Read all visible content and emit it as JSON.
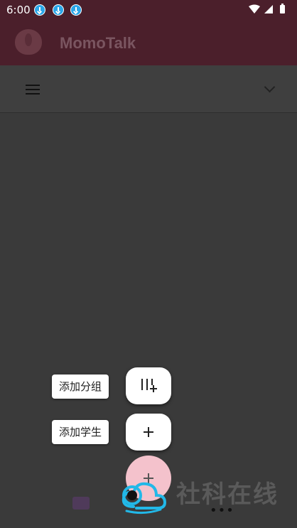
{
  "status_bar": {
    "time": "6:00",
    "download_icons": [
      "download-icon",
      "download-icon",
      "download-icon"
    ],
    "system_icons": [
      "wifi-icon",
      "signal-icon",
      "battery-icon"
    ]
  },
  "app_bar": {
    "title": "MomoTalk",
    "logo_icon": "peach-logo-icon"
  },
  "toolbar": {
    "menu_icon": "hamburger-menu-icon",
    "dropdown_icon": "chevron-down-icon"
  },
  "fab_menu": {
    "add_group_label": "添加分组",
    "add_student_label": "添加学生",
    "add_group_icon": "add-group-icon",
    "add_student_icon": "plus-icon",
    "main_icon": "plus-icon"
  },
  "bottom_nav": {
    "chat_icon": "chat-icon",
    "more_icon": "more-icon"
  },
  "watermark": {
    "text": "社科在线"
  },
  "colors": {
    "app_bar_bg": "#4b1f2b",
    "scrim_bg": "#3a3a3a",
    "fab_main_bg": "#f4c2cc",
    "download_badge": "#2aa6e8",
    "watermark_logo": "#22b8e8"
  }
}
